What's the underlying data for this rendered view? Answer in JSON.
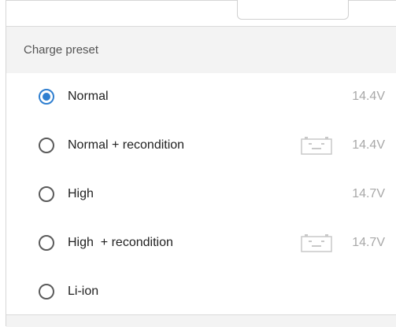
{
  "section": {
    "title": "Charge preset"
  },
  "options": [
    {
      "label": "Normal",
      "value": "14.4V",
      "selected": true,
      "recondition_icon": false
    },
    {
      "label": "Normal + recondition",
      "value": "14.4V",
      "selected": false,
      "recondition_icon": true
    },
    {
      "label": "High",
      "value": "14.7V",
      "selected": false,
      "recondition_icon": false
    },
    {
      "label": "High  + recondition",
      "value": "14.7V",
      "selected": false,
      "recondition_icon": true
    },
    {
      "label": "Li-ion",
      "value": "",
      "selected": false,
      "recondition_icon": false
    }
  ],
  "colors": {
    "accent": "#2f7fd0",
    "value_text": "#a8a8a8",
    "header_bg": "#f3f3f3"
  },
  "icons": {
    "recondition": "battery-icon"
  }
}
